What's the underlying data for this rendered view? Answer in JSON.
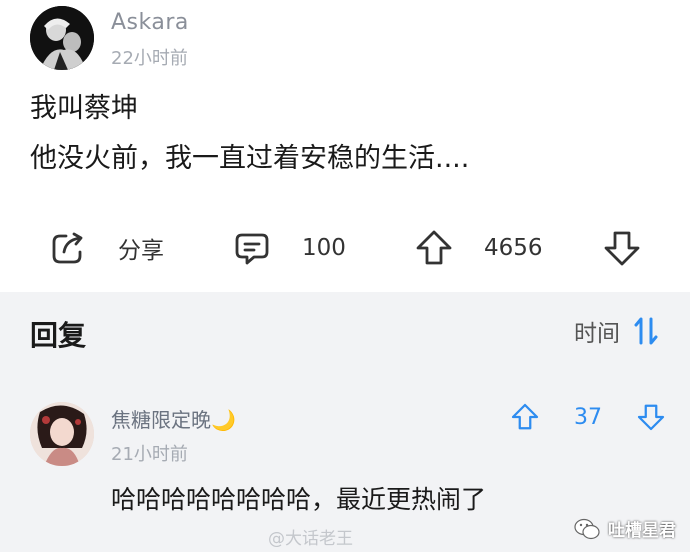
{
  "post": {
    "author": "Askara",
    "time": "22小时前",
    "lines": [
      "我叫蔡坤",
      "他没火前，我一直过着安稳的生活...."
    ]
  },
  "actions": {
    "share_label": "分享",
    "comment_count": "100",
    "upvote_count": "4656"
  },
  "replies": {
    "title": "回复",
    "sort_label": "时间"
  },
  "comment": {
    "username": "焦糖限定晚",
    "moon_emoji": "🌙",
    "time": "21小时前",
    "text": "哈哈哈哈哈哈哈哈，最近更热闹了",
    "vote_count": "37"
  },
  "watermark": {
    "text": "@大话老王",
    "brand": "吐槽星君"
  },
  "colors": {
    "accent_blue": "#2d8cf0",
    "reply_bg": "#f2f3f5"
  }
}
